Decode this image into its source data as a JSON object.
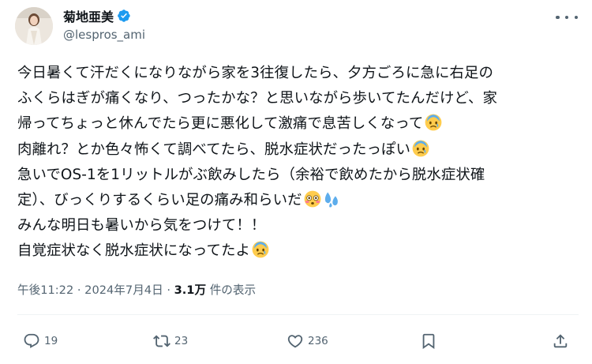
{
  "author": {
    "display_name": "菊地亜美",
    "handle": "@lespros_ami",
    "verified_badge_color": "#1d9bf0"
  },
  "tweet": {
    "lines": [
      "今日暑くて汗だくになりながら家を3往復したら、夕方ごろに急に右足の",
      "ふくらはぎが痛くなり、つったかな？と思いながら歩いてたんだけど、家",
      "帰ってちょっと休んでたら更に悪化して激痛で息苦しくなって",
      "肉離れ？とか色々怖くて調べてたら、脱水症状だったっぽい",
      "急いでOS-1を1リットルがぶ飲みしたら（余裕で飲めたから脱水症状確",
      "定）、びっくりするくらい足の痛み和らいだ",
      "みんな明日も暑いから気をつけて！！",
      "自覚症状なく脱水症状になってたよ"
    ],
    "emojis": {
      "line3": "anxious-face-emoji",
      "line4": "anxious-face-emoji",
      "line6a": "flushed-face-emoji",
      "line6b": "sweat-droplets-emoji",
      "line8": "anxious-face-emoji"
    }
  },
  "meta": {
    "time": "午後11:22",
    "separator": "·",
    "date": "2024年7月4日",
    "views": "3.1万",
    "views_label": "件の表示"
  },
  "actions": {
    "reply_count": "19",
    "retweet_count": "23",
    "like_count": "236"
  },
  "icons": {
    "more": "more-horizontal-icon",
    "reply": "reply-icon",
    "retweet": "retweet-icon",
    "like": "heart-icon",
    "bookmark": "bookmark-icon",
    "share": "share-icon"
  },
  "colors": {
    "text": "#0f1419",
    "secondary": "#536471",
    "divider": "#eff3f4"
  }
}
